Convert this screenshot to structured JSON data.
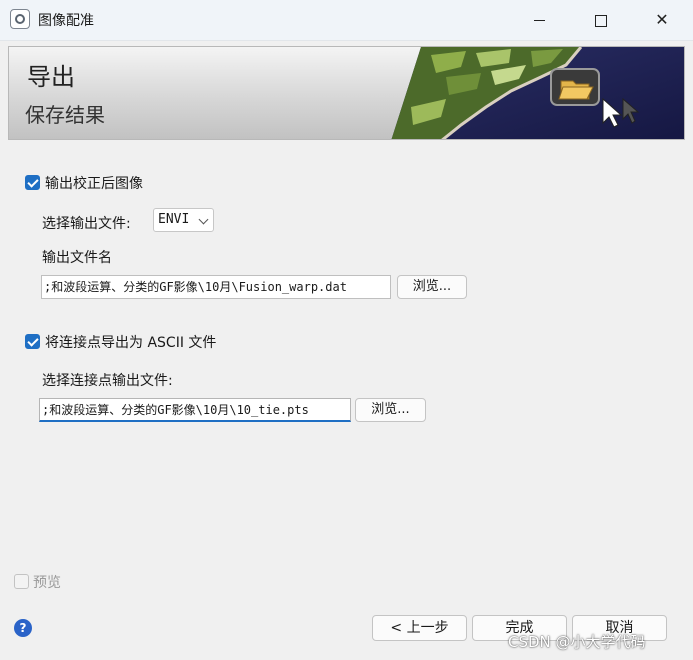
{
  "window": {
    "title": "图像配准",
    "icon": "app-icon",
    "controls": {
      "minimize": "minimize-icon",
      "maximize": "maximize-icon",
      "close": "✕"
    }
  },
  "banner": {
    "title": "导出",
    "subtitle": "保存结果",
    "image": "satellite-folder-graphic"
  },
  "export_image": {
    "checkbox_label": "输出校正后图像",
    "checked": true,
    "format_label": "选择输出文件:",
    "format_value": "ENVI",
    "filename_label": "输出文件名",
    "filename_value": ";和波段运算、分类的GF影像\\10月\\Fusion_warp.dat",
    "browse_label": "浏览..."
  },
  "export_tiepoints": {
    "checkbox_label": "将连接点导出为 ASCII 文件",
    "checked": true,
    "file_label": "选择连接点输出文件:",
    "file_value": ";和波段运算、分类的GF影像\\10月\\10_tie.pts",
    "browse_label": "浏览..."
  },
  "preview": {
    "label": "预览",
    "checked": false,
    "enabled": false
  },
  "footer": {
    "help_icon": "?",
    "back_label": "< 上一步",
    "finish_label": "完成",
    "cancel_label": "取消"
  },
  "watermark": "CSDN @小大学代码",
  "colors": {
    "accent": "#1f6fc4",
    "help": "#2a63c8"
  }
}
